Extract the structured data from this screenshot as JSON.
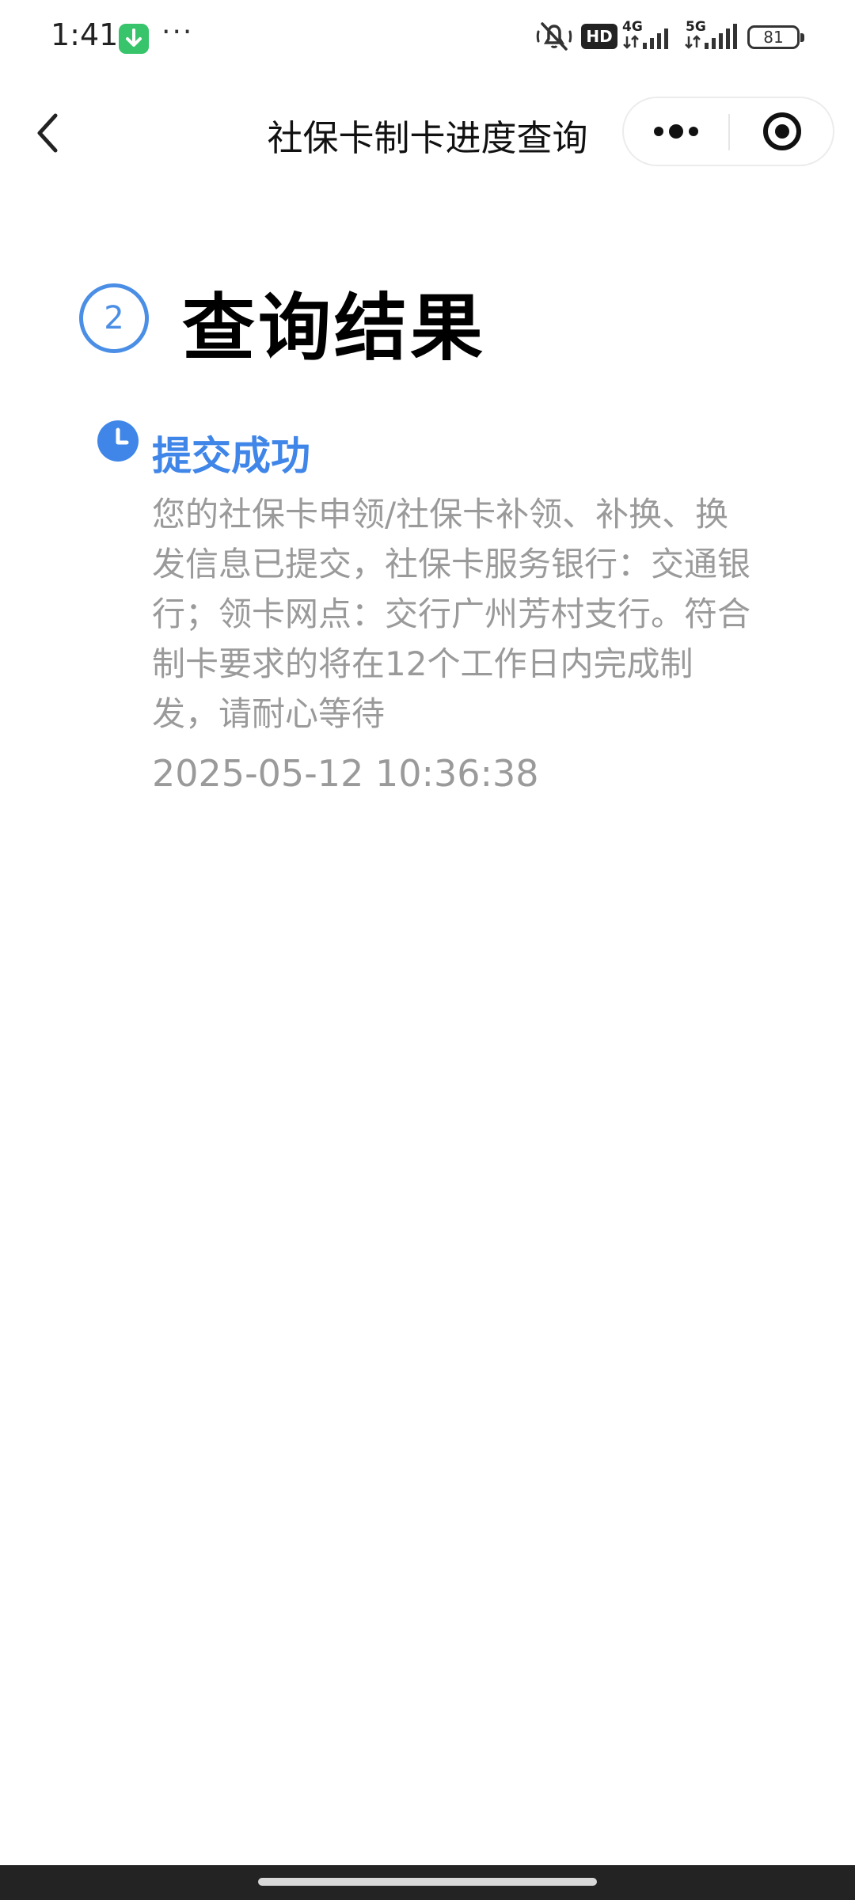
{
  "status_bar": {
    "time": "1:41",
    "more_dots": "···",
    "hd_label": "HD",
    "net_4g": "4G",
    "net_5g": "5G",
    "battery": "81",
    "icons": [
      "download-app-icon",
      "mute-icon",
      "signal-icon",
      "battery-icon"
    ]
  },
  "nav": {
    "title": "社保卡制卡进度查询",
    "icons": [
      "back-arrow-icon",
      "more-icon",
      "close-target-icon"
    ]
  },
  "content": {
    "step_number": "2",
    "section_title": "查询结果",
    "status_title": "提交成功",
    "status_description": "您的社保卡申领/社保卡补领、补换、换发信息已提交，社保卡服务银行：交通银行；领卡网点：交行广州芳村支行。符合制卡要求的将在12个工作日内完成制发，请耐心等待",
    "timestamp": "2025-05-12 10:36:38"
  },
  "colors": {
    "accent_blue": "#3f86e8",
    "step_circle_blue": "#4a8ee6",
    "muted_text": "#9a9a9a",
    "download_icon_green": "#38c46b"
  }
}
